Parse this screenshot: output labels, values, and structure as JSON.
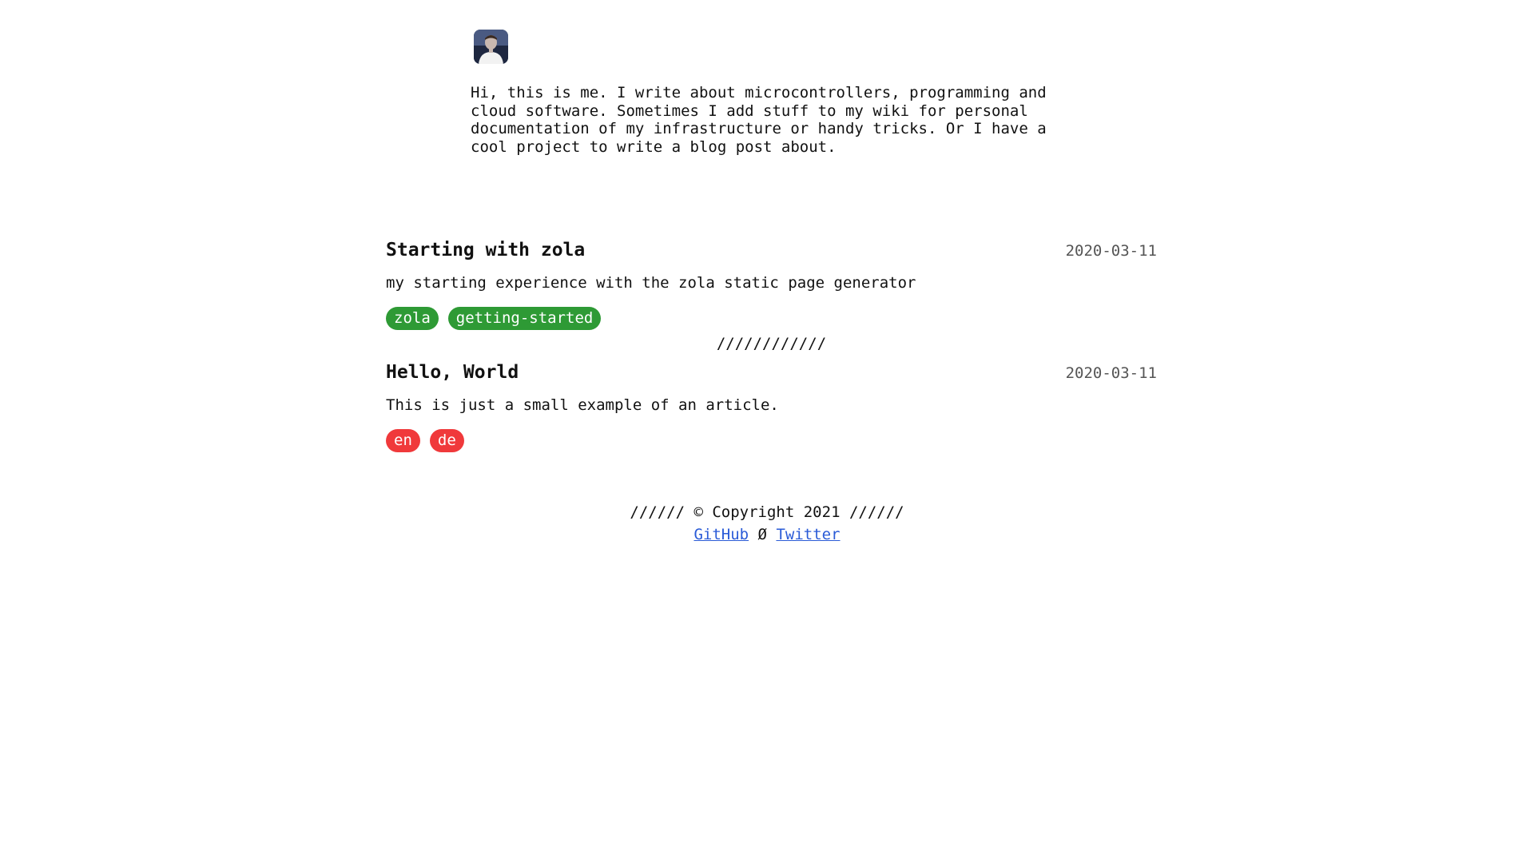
{
  "intro": {
    "bio": "Hi, this is me. I write about microcontrollers, programming and\ncloud software. Sometimes I add stuff to my wiki for personal\ndocumentation of my infrastructure or handy tricks. Or I have a\ncool project to write a blog post about."
  },
  "posts": [
    {
      "title": "Starting with zola",
      "date": "2020-03-11",
      "description": "my starting experience with the zola static page generator",
      "tags": [
        {
          "label": "zola",
          "color": "#2e9a35"
        },
        {
          "label": "getting-started",
          "color": "#2e9a35"
        }
      ]
    },
    {
      "title": "Hello, World",
      "date": "2020-03-11",
      "description": "This is just a small example of an article.",
      "tags": [
        {
          "label": "en",
          "color": "#f0393b"
        },
        {
          "label": "de",
          "color": "#f0393b"
        }
      ]
    }
  ],
  "divider": "////////////",
  "footer": {
    "copyright": "////// © Copyright 2021 //////",
    "github_label": "GitHub",
    "separator": "Ø",
    "twitter_label": "Twitter",
    "link_color": "#2a5bd7"
  }
}
